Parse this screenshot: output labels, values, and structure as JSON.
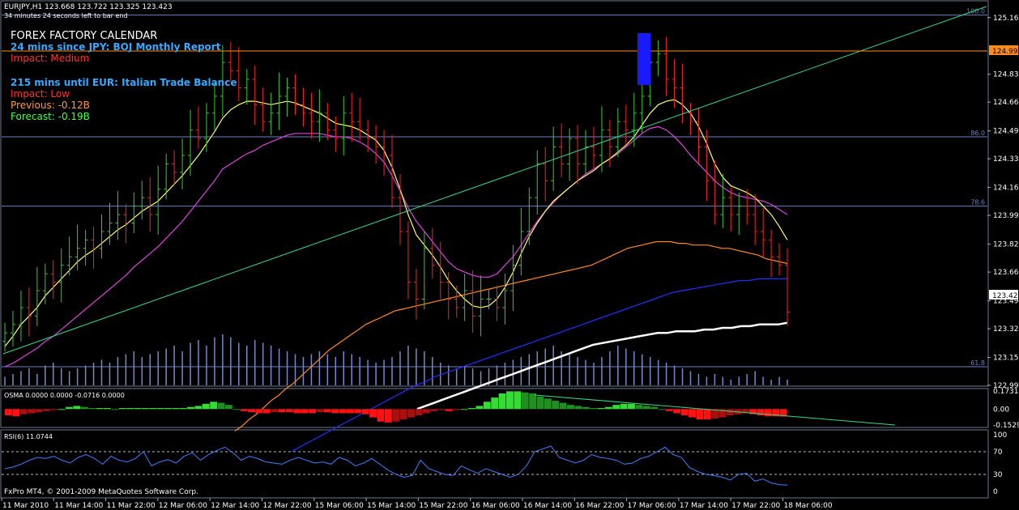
{
  "window": {
    "symbol_header": "EURJPY,H1  123.668 123.722 123.325 123.423",
    "timer_text": "34 minutes 24 seconds left to bar end",
    "copyright": "FxPro MT4, © 2001-2009 MetaQuotes Software Corp."
  },
  "calendar": {
    "title": "FOREX FACTORY CALENDAR",
    "event1": "24 mins since JPY: BOJ Monthly Report",
    "event1_impact": "Impact: Medium",
    "event2": "215 mins until EUR: Italian Trade Balance",
    "event2_impact": "Impact: Low",
    "event2_previous": "Previous: -0.12B",
    "event2_forecast": "Forecast: -0.19B"
  },
  "colors": {
    "background": "#000000",
    "grid": "#3c4a5a",
    "bull_candle": "#32cd32",
    "bear_candle": "#ff2020",
    "ma_fast": "#ffff66",
    "ma_slow": "#e040e0",
    "ma_100": "#ff8c1a",
    "ma_200": "#2030ff",
    "ma_white": "#ffffff",
    "trendline": "#33dd88",
    "osma_up": "#22cc22",
    "osma_down": "#ff1111",
    "rsi": "#3f7fff",
    "fib": "#6b7fbf",
    "volume": "#7788cc",
    "text_blue": "#33aaff",
    "text_red": "#ff3030",
    "text_orange": "#ff9944",
    "text_green": "#44ff44"
  },
  "chart_data": [
    {
      "type": "candlestick",
      "title": "EURJPY,H1",
      "ylim": [
        122.99,
        125.25
      ],
      "y_ticks": [
        "125.165",
        "124.998",
        "124.830",
        "124.665",
        "124.495",
        "124.330",
        "124.160",
        "123.995",
        "123.825",
        "123.660",
        "123.490",
        "123.423",
        "123.325",
        "123.155",
        "122.990"
      ],
      "current_price": "123.423",
      "high_line_price": "124.998",
      "fib_levels": [
        {
          "label": "100.0",
          "price": 125.18
        },
        {
          "label": "86.0",
          "price": 124.46
        },
        {
          "label": "78.6",
          "price": 124.05
        },
        {
          "label": "61.8",
          "price": 123.1
        }
      ],
      "x_labels": [
        "11 Mar 2010",
        "11 Mar 14:00",
        "11 Mar 22:00",
        "12 Mar 06:00",
        "12 Mar 14:00",
        "12 Mar 22:00",
        "15 Mar 06:00",
        "15 Mar 14:00",
        "15 Mar 22:00",
        "16 Mar 06:00",
        "16 Mar 14:00",
        "16 Mar 22:00",
        "17 Mar 06:00",
        "17 Mar 14:00",
        "17 Mar 22:00",
        "18 Mar 06:00"
      ],
      "close": [
        123.3,
        123.35,
        123.45,
        123.4,
        123.55,
        123.65,
        123.6,
        123.7,
        123.75,
        123.8,
        123.85,
        123.8,
        123.9,
        123.95,
        124.0,
        123.95,
        124.05,
        124.1,
        124.0,
        124.15,
        124.3,
        124.25,
        124.35,
        124.5,
        124.45,
        124.6,
        124.7,
        124.9,
        124.85,
        124.75,
        124.8,
        124.65,
        124.55,
        124.6,
        124.7,
        124.75,
        124.65,
        124.6,
        124.55,
        124.6,
        124.5,
        124.45,
        124.6,
        124.55,
        124.5,
        124.45,
        124.4,
        124.35,
        124.1,
        123.9,
        123.6,
        123.5,
        123.8,
        123.7,
        123.6,
        123.5,
        123.45,
        123.55,
        123.4,
        123.5,
        123.5,
        123.45,
        123.55,
        123.7,
        123.9,
        124.1,
        124.3,
        124.2,
        124.4,
        124.3,
        124.45,
        124.3,
        124.4,
        124.35,
        124.5,
        124.4,
        124.55,
        124.5,
        124.6,
        124.7,
        124.9,
        124.95,
        124.8,
        124.75,
        124.6,
        124.55,
        124.4,
        124.2,
        124.0,
        124.1,
        124.0,
        124.05,
        124.0,
        123.9,
        123.85,
        123.75,
        123.7,
        123.423
      ],
      "ma_fast": [
        123.22,
        123.28,
        123.35,
        123.4,
        123.45,
        123.52,
        123.57,
        123.62,
        123.67,
        123.72,
        123.76,
        123.79,
        123.83,
        123.87,
        123.91,
        123.94,
        123.98,
        124.02,
        124.05,
        124.08,
        124.13,
        124.18,
        124.23,
        124.29,
        124.35,
        124.42,
        124.49,
        124.57,
        124.62,
        124.65,
        124.67,
        124.67,
        124.66,
        124.65,
        124.66,
        124.67,
        124.66,
        124.64,
        124.62,
        124.6,
        124.57,
        124.54,
        124.53,
        124.52,
        124.5,
        124.47,
        124.44,
        124.38,
        124.28,
        124.15,
        124.0,
        123.88,
        123.82,
        123.76,
        123.69,
        123.61,
        123.55,
        123.5,
        123.46,
        123.45,
        123.46,
        123.5,
        123.57,
        123.66,
        123.77,
        123.87,
        123.95,
        124.02,
        124.08,
        124.12,
        124.16,
        124.2,
        124.23,
        124.26,
        124.3,
        124.33,
        124.37,
        124.41,
        124.46,
        124.53,
        124.6,
        124.65,
        124.67,
        124.68,
        124.65,
        124.6,
        124.52,
        124.42,
        124.3,
        124.22,
        124.17,
        124.15,
        124.13,
        124.1,
        124.05,
        124.0,
        123.93,
        123.85
      ],
      "ma_slow": [
        123.1,
        123.12,
        123.15,
        123.18,
        123.21,
        123.25,
        123.28,
        123.32,
        123.36,
        123.4,
        123.44,
        123.48,
        123.52,
        123.56,
        123.6,
        123.64,
        123.69,
        123.73,
        123.77,
        123.81,
        123.86,
        123.91,
        123.96,
        124.02,
        124.08,
        124.14,
        124.2,
        124.27,
        124.3,
        124.33,
        124.36,
        124.38,
        124.41,
        124.43,
        124.45,
        124.47,
        124.48,
        124.48,
        124.48,
        124.48,
        124.47,
        124.46,
        124.46,
        124.45,
        124.43,
        124.4,
        124.36,
        124.31,
        124.23,
        124.14,
        124.04,
        123.96,
        123.9,
        123.84,
        123.78,
        123.72,
        123.68,
        123.66,
        123.64,
        123.63,
        123.63,
        123.65,
        123.7,
        123.75,
        123.82,
        123.89,
        123.96,
        124.02,
        124.07,
        124.12,
        124.16,
        124.2,
        124.24,
        124.27,
        124.3,
        124.33,
        124.36,
        124.4,
        124.44,
        124.48,
        124.51,
        124.52,
        124.5,
        124.46,
        124.41,
        124.35,
        124.3,
        124.25,
        124.2,
        124.16,
        124.13,
        124.11,
        124.1,
        124.09,
        124.08,
        124.06,
        124.03,
        124.0
      ],
      "ma_100": [
        122.72,
        122.75,
        122.79,
        122.82,
        122.86,
        122.9,
        122.93,
        122.97,
        123.0,
        123.04,
        123.08,
        123.12,
        123.16,
        123.2,
        123.23,
        123.26,
        123.29,
        123.32,
        123.35,
        123.37,
        123.39,
        123.41,
        123.43,
        123.44,
        123.45,
        123.46,
        123.47,
        123.48,
        123.49,
        123.5,
        123.51,
        123.52,
        123.53,
        123.54,
        123.55,
        123.56,
        123.57,
        123.58,
        123.59,
        123.6,
        123.61,
        123.62,
        123.63,
        123.64,
        123.65,
        123.66,
        123.67,
        123.68,
        123.69,
        123.7,
        123.72,
        123.74,
        123.76,
        123.78,
        123.8,
        123.81,
        123.82,
        123.83,
        123.84,
        123.84,
        123.84,
        123.83,
        123.83,
        123.82,
        123.82,
        123.82,
        123.81,
        123.8,
        123.8,
        123.79,
        123.78,
        123.77,
        123.76,
        123.74,
        123.73,
        123.72,
        123.71
      ],
      "ma_200": [
        122.6,
        122.63,
        122.66,
        122.69,
        122.72,
        122.75,
        122.78,
        122.81,
        122.84,
        122.87,
        122.9,
        122.93,
        122.96,
        122.99,
        123.01,
        123.04,
        123.06,
        123.08,
        123.1,
        123.12,
        123.14,
        123.16,
        123.18,
        123.2,
        123.22,
        123.24,
        123.26,
        123.28,
        123.3,
        123.32,
        123.34,
        123.36,
        123.38,
        123.4,
        123.42,
        123.44,
        123.46,
        123.48,
        123.5,
        123.52,
        123.54,
        123.55,
        123.56,
        123.57,
        123.58,
        123.59,
        123.6,
        123.61,
        123.61,
        123.62,
        123.62,
        123.62,
        123.62
      ],
      "ma_white": [
        122.85,
        122.87,
        122.89,
        122.91,
        122.93,
        122.95,
        122.97,
        122.99,
        123.01,
        123.03,
        123.05,
        123.07,
        123.09,
        123.11,
        123.13,
        123.15,
        123.17,
        123.19,
        123.21,
        123.23,
        123.24,
        123.25,
        123.26,
        123.27,
        123.28,
        123.29,
        123.3,
        123.3,
        123.31,
        123.31,
        123.31,
        123.32,
        123.32,
        123.33,
        123.33,
        123.34,
        123.34,
        123.35,
        123.35,
        123.35,
        123.36
      ],
      "volume": [
        0.15,
        0.2,
        0.25,
        0.3,
        0.2,
        0.35,
        0.4,
        0.3,
        0.25,
        0.3,
        0.35,
        0.4,
        0.45,
        0.4,
        0.5,
        0.55,
        0.6,
        0.5,
        0.55,
        0.6,
        0.65,
        0.7,
        0.6,
        0.75,
        0.8,
        0.7,
        0.85,
        0.9,
        0.85,
        0.75,
        0.7,
        0.8,
        0.75,
        0.7,
        0.65,
        0.6,
        0.55,
        0.5,
        0.55,
        0.6,
        0.55,
        0.5,
        0.6,
        0.55,
        0.5,
        0.45,
        0.4,
        0.45,
        0.5,
        0.6,
        0.7,
        0.65,
        0.6,
        0.5,
        0.4,
        0.35,
        0.3,
        0.35,
        0.3,
        0.25,
        0.3,
        0.35,
        0.4,
        0.45,
        0.5,
        0.55,
        0.6,
        0.65,
        0.7,
        0.6,
        0.55,
        0.5,
        0.45,
        0.4,
        0.5,
        0.6,
        0.7,
        0.65,
        0.6,
        0.55,
        0.5,
        0.45,
        0.4,
        0.35,
        0.3,
        0.25,
        0.2,
        0.15,
        0.2,
        0.15,
        0.1,
        0.15,
        0.2,
        0.25,
        0.15,
        0.1,
        0.15,
        0.1
      ]
    },
    {
      "type": "bar",
      "title": "OSMA 0.0000 0.0000 -0.0716 0.0000",
      "ylim": [
        -0.1529,
        0.1731
      ],
      "y_ticks": [
        "0.1731",
        "0.00",
        "-0.1529"
      ],
      "values": [
        -0.06,
        -0.07,
        -0.05,
        -0.04,
        -0.03,
        -0.02,
        -0.01,
        0.0,
        0.02,
        0.03,
        0.02,
        0.01,
        0.01,
        0.01,
        0.0,
        0.01,
        0.01,
        0.01,
        0.01,
        0.01,
        0.01,
        0.01,
        0.01,
        0.01,
        0.02,
        0.03,
        0.05,
        0.07,
        0.06,
        0.04,
        0.0,
        -0.02,
        -0.03,
        -0.04,
        -0.04,
        -0.03,
        -0.03,
        -0.03,
        -0.04,
        -0.04,
        -0.04,
        -0.03,
        -0.03,
        -0.04,
        -0.04,
        -0.04,
        -0.04,
        -0.05,
        -0.08,
        -0.12,
        -0.13,
        -0.12,
        -0.1,
        -0.08,
        -0.06,
        -0.04,
        -0.02,
        -0.01,
        -0.02,
        -0.01,
        0.0,
        0.01,
        0.03,
        0.07,
        0.11,
        0.15,
        0.17,
        0.17,
        0.16,
        0.15,
        0.12,
        0.1,
        0.08,
        0.06,
        0.04,
        0.03,
        0.02,
        0.01,
        0.01,
        0.02,
        0.04,
        0.05,
        0.05,
        0.04,
        0.03,
        0.02,
        0.0,
        -0.02,
        -0.04,
        -0.06,
        -0.08,
        -0.1,
        -0.1,
        -0.09,
        -0.08,
        -0.06,
        -0.05,
        -0.04,
        -0.05,
        -0.06,
        -0.07,
        -0.07,
        -0.0716
      ]
    },
    {
      "type": "line",
      "title": "RSI(6) 11.0744",
      "ylim": [
        0,
        100
      ],
      "y_ticks": [
        "100",
        "70",
        "30",
        "0"
      ],
      "levels": [
        70,
        30
      ],
      "values": [
        40,
        43,
        48,
        55,
        60,
        58,
        62,
        55,
        50,
        60,
        65,
        58,
        48,
        62,
        55,
        52,
        58,
        70,
        45,
        52,
        56,
        50,
        62,
        68,
        55,
        65,
        72,
        78,
        68,
        55,
        62,
        58,
        52,
        50,
        48,
        55,
        60,
        55,
        50,
        52,
        48,
        60,
        55,
        45,
        50,
        58,
        48,
        38,
        30,
        25,
        28,
        55,
        40,
        35,
        30,
        28,
        45,
        38,
        32,
        40,
        35,
        30,
        25,
        30,
        45,
        70,
        75,
        80,
        60,
        55,
        50,
        55,
        65,
        60,
        58,
        55,
        48,
        50,
        58,
        62,
        70,
        78,
        65,
        60,
        42,
        35,
        30,
        28,
        25,
        20,
        30,
        32,
        18,
        22,
        15,
        12,
        11.0744
      ]
    }
  ]
}
